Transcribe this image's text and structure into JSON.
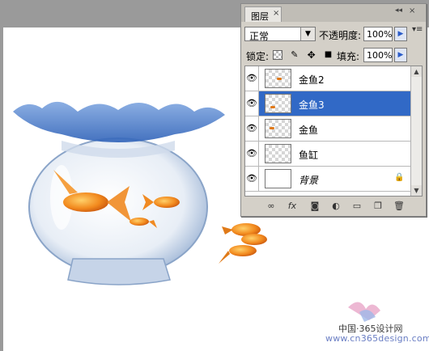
{
  "panel": {
    "tab_label": "图层",
    "tab_close": "×",
    "collapse": "◂◂",
    "close": "×",
    "menu": "▾≡",
    "blend_mode": "正常",
    "opacity_label": "不透明度:",
    "opacity_value": "100%",
    "lock_label": "锁定:",
    "fill_label": "填充:",
    "fill_value": "100%",
    "selected_color": "#3169c6"
  },
  "layers": [
    {
      "name": "金鱼2",
      "visible": true,
      "selected": false
    },
    {
      "name": "金鱼3",
      "visible": true,
      "selected": true
    },
    {
      "name": "金鱼",
      "visible": true,
      "selected": false
    },
    {
      "name": "鱼缸",
      "visible": true,
      "selected": false
    },
    {
      "name": "背景",
      "visible": true,
      "selected": false,
      "locked": true
    }
  ],
  "watermark": {
    "line1": "中国·365设计网",
    "line2": "www.cn365design.com"
  }
}
